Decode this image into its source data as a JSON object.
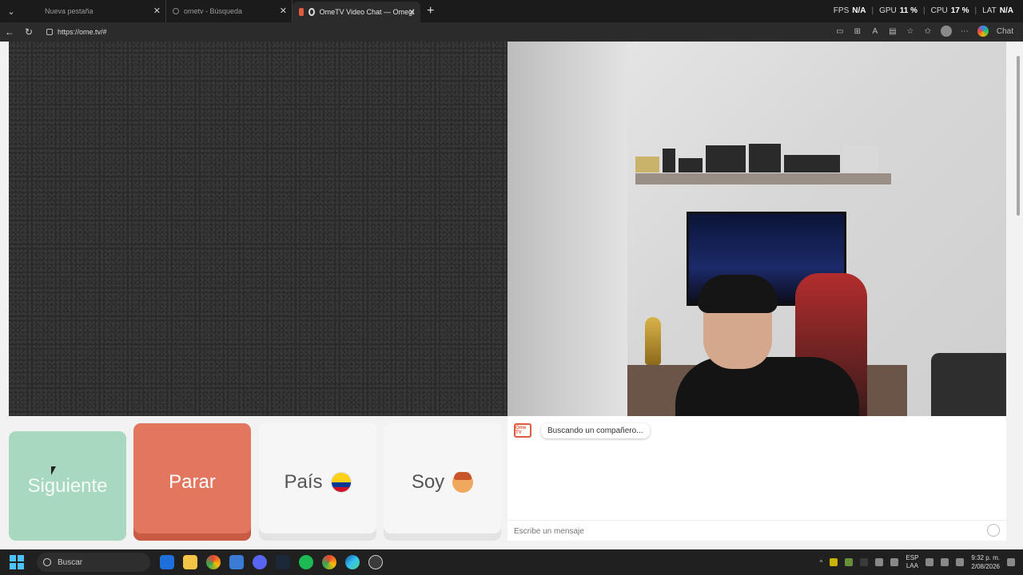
{
  "browser": {
    "tabs": [
      {
        "label": "Nueva pestaña"
      },
      {
        "label": "ometv - Búsqueda"
      },
      {
        "label": "OmeTV Video Chat — Omegl"
      }
    ],
    "address": "https://ome.tv/#",
    "chat_button": "Chat",
    "perf": {
      "fps_label": "FPS",
      "fps_value": "N/A",
      "gpu_label": "GPU",
      "gpu_value": "11 %",
      "cpu_label": "CPU",
      "cpu_value": "17 %",
      "lat_label": "LAT",
      "lat_value": "N/A"
    }
  },
  "controls": {
    "next_label": "Siguiente",
    "stop_label": "Parar",
    "country_label": "País",
    "gender_label": "Soy"
  },
  "chat": {
    "logo_text": "Ome TV",
    "status_message": "Buscando un compañero...",
    "input_placeholder": "Escribe un mensaje"
  },
  "taskbar": {
    "search_label": "Buscar",
    "lang_top": "ESP",
    "lang_bottom": "LAA",
    "time": "9:32 p. m.",
    "date": "2/08/2026"
  },
  "colors": {
    "next": "#a9d8c0",
    "stop": "#e3765f",
    "accent_logo": "#e05a3f"
  }
}
